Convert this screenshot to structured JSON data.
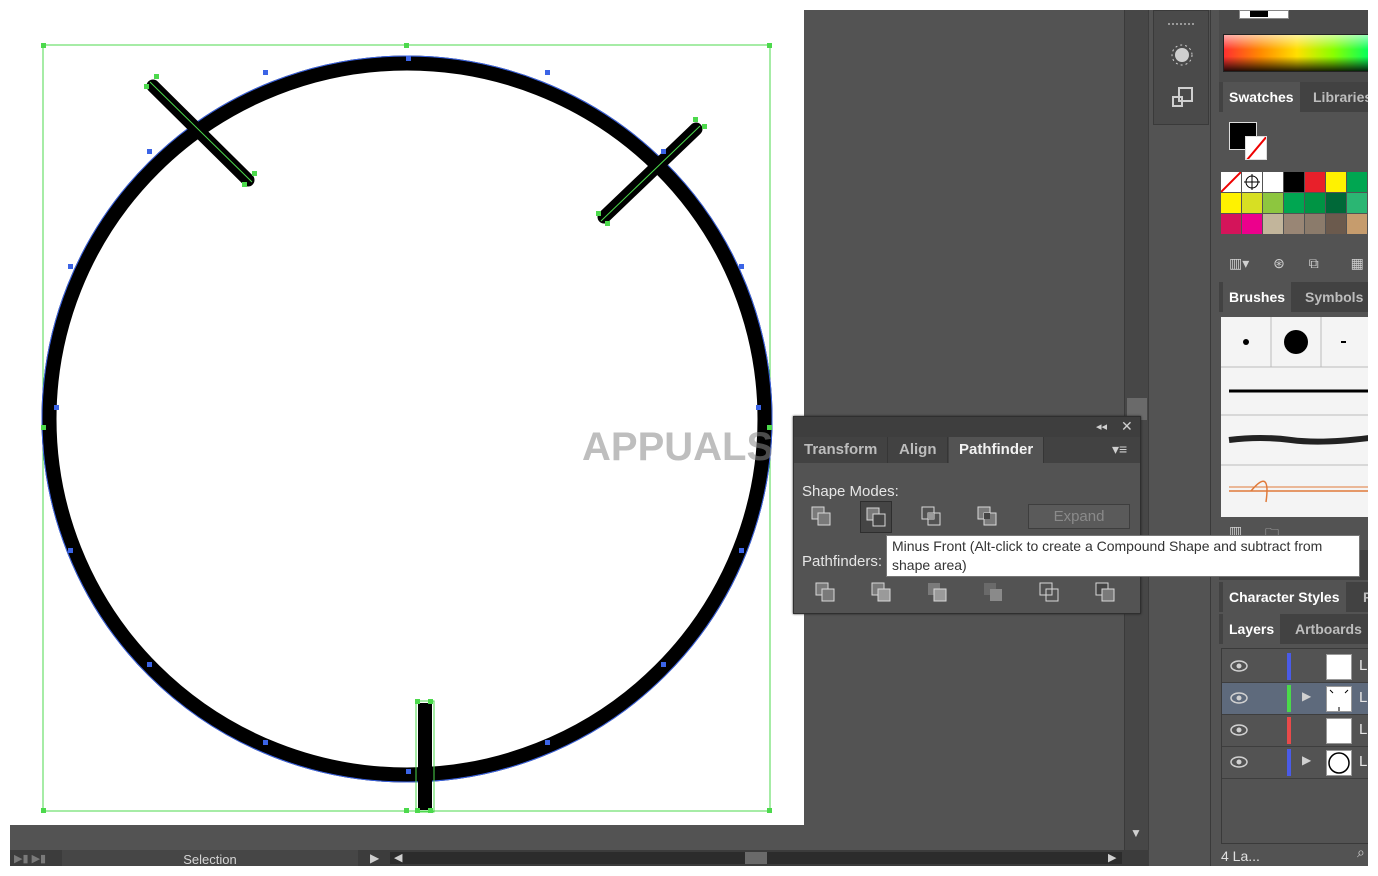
{
  "colors": {
    "ui_dark": "#535353",
    "selection_green": "#4cd94c",
    "selection_blue": "#3b64e6",
    "stroke": "#000000"
  },
  "watermark": "APPUALS",
  "float_panel": {
    "tabs": [
      {
        "label": "Transform",
        "active": false
      },
      {
        "label": "Align",
        "active": false
      },
      {
        "label": "Pathfinder",
        "active": true
      }
    ],
    "shape_modes_label": "Shape Modes:",
    "pathfinders_label": "Pathfinders:",
    "expand_label": "Expand",
    "tooltip": "Minus Front (Alt-click to create a Compound Shape and subtract from shape area)"
  },
  "right_panels": {
    "swatches_tabs": [
      "Swatches",
      "Libraries"
    ],
    "brushes_tabs": [
      "Brushes",
      "Symbols"
    ],
    "character_tabs": [
      "Character Styles",
      "P"
    ],
    "layers_tabs": [
      "Layers",
      "Artboards"
    ],
    "layers": [
      {
        "name": "L",
        "color": "#4a5be8",
        "expanded": false,
        "selected": false,
        "thumb": "blank"
      },
      {
        "name": "L",
        "color": "#4ad94a",
        "expanded": true,
        "selected": true,
        "thumb": "shape"
      },
      {
        "name": "L",
        "color": "#e84a4a",
        "expanded": false,
        "selected": false,
        "thumb": "blank"
      },
      {
        "name": "L",
        "color": "#4a5be8",
        "expanded": true,
        "selected": false,
        "thumb": "circle"
      }
    ],
    "layers_count": "4 La...",
    "swatch_colors": [
      [
        "#ffffff",
        "#ffffff",
        "#ffffff",
        "#000000",
        "#e8202a",
        "#fff200",
        "#00a651"
      ],
      [
        "#fff200",
        "#d7df23",
        "#8dc63f",
        "#00a651",
        "#009444",
        "#006838",
        "#2bb673"
      ],
      [
        "#d4145a",
        "#ec008c",
        "#c2b59b",
        "#998675",
        "#8b7b6b",
        "#6b5a4d",
        "#c69c6d"
      ]
    ]
  },
  "status": {
    "tool_label": "Selection"
  }
}
